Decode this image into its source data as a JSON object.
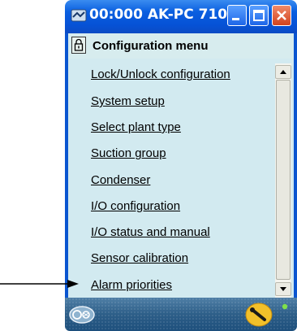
{
  "window": {
    "title": "00:000 AK-PC 710"
  },
  "menu": {
    "header_title": "Configuration menu",
    "items": [
      {
        "label": "Lock/Unlock configuration"
      },
      {
        "label": "System setup"
      },
      {
        "label": "Select plant type"
      },
      {
        "label": "Suction group"
      },
      {
        "label": "Condenser"
      },
      {
        "label": "I/O configuration"
      },
      {
        "label": "I/O status and manual"
      },
      {
        "label": "Sensor calibration"
      },
      {
        "label": "Alarm priorities"
      }
    ]
  },
  "icons": {
    "title": "app-icon",
    "minimize": "minimize-icon",
    "maximize": "maximize-icon",
    "close": "close-icon",
    "lock": "padlock-icon",
    "footer_left": "controller-icon",
    "footer_center": "wrench-icon",
    "footer_right": "status-led-icon",
    "pointer": "arrow-right-icon"
  },
  "colors": {
    "titlebar": "#0652d6",
    "content_bg": "#d2eaf0",
    "footer": "#2d5e88",
    "close_button": "#d2431e",
    "status_led": "#7fe04a"
  }
}
